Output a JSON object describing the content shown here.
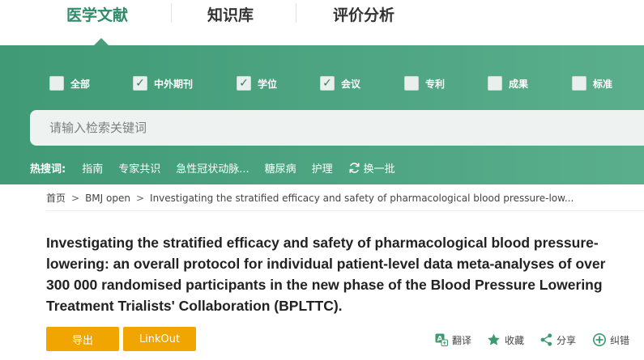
{
  "nav": {
    "tabs": [
      {
        "label": "医学文献",
        "active": true
      },
      {
        "label": "知识库",
        "active": false
      },
      {
        "label": "评价分析",
        "active": false
      }
    ]
  },
  "filters": [
    {
      "label": "全部",
      "checked": false
    },
    {
      "label": "中外期刊",
      "checked": true
    },
    {
      "label": "学位",
      "checked": true
    },
    {
      "label": "会议",
      "checked": true
    },
    {
      "label": "专利",
      "checked": false
    },
    {
      "label": "成果",
      "checked": false
    },
    {
      "label": "标准",
      "checked": false
    }
  ],
  "search": {
    "placeholder": "请输入检索关键词"
  },
  "hot": {
    "title": "热搜词:",
    "items": [
      "指南",
      "专家共识",
      "急性冠状动脉...",
      "糖尿病",
      "护理"
    ],
    "refresh_label": "换一批"
  },
  "breadcrumb": {
    "items": [
      "首页",
      "BMJ open",
      "Investigating the stratified efficacy and safety of pharmacological blood pressure-low..."
    ],
    "separator": ">"
  },
  "article": {
    "title": "Investigating the stratified efficacy and safety of pharmacological blood pressure-lowering: an overall protocol for individual patient-level data meta-analyses of over 300 000 randomised participants in the new phase of the Blood Pressure Lowering Treatment Trialists' Collaboration (BPLTTC)."
  },
  "buttons": {
    "export_label": "导出",
    "linkout_label": "LinkOut"
  },
  "actions": {
    "translate_label": "翻译",
    "favorite_label": "收藏",
    "share_label": "分享",
    "correct_label": "纠错"
  },
  "colors": {
    "accent_green": "#2e8c68",
    "hero_green": "#4ea583",
    "button_orange": "#f0a500",
    "icon_green": "#3d9a6e"
  }
}
